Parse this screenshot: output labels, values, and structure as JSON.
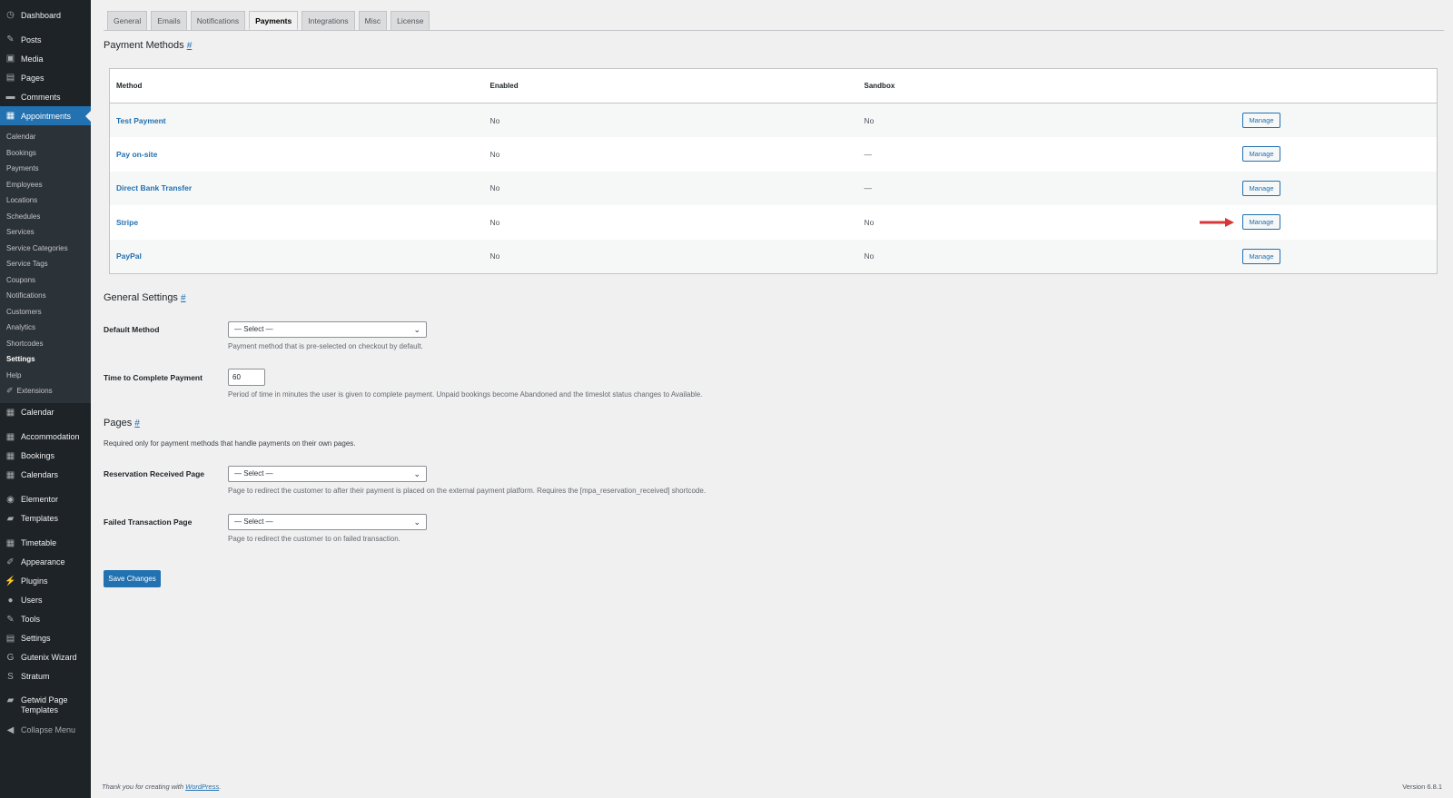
{
  "sidebar": {
    "top": [
      {
        "label": "Dashboard",
        "icon": "dashboard-icon",
        "glyph": "◷"
      },
      {
        "label": "Posts",
        "icon": "pin-icon",
        "glyph": "✎"
      },
      {
        "label": "Media",
        "icon": "media-icon",
        "glyph": "▣"
      },
      {
        "label": "Pages",
        "icon": "pages-icon",
        "glyph": "▤"
      },
      {
        "label": "Comments",
        "icon": "comments-icon",
        "glyph": "▬"
      },
      {
        "label": "Appointments",
        "icon": "calendar-icon",
        "glyph": "▦"
      }
    ],
    "appointments_sub": [
      "Calendar",
      "Bookings",
      "Payments",
      "Employees",
      "Locations",
      "Schedules",
      "Services",
      "Service Categories",
      "Service Tags",
      "Coupons",
      "Notifications",
      "Customers",
      "Analytics",
      "Shortcodes",
      "Settings",
      "Help",
      "Extensions"
    ],
    "rest": [
      {
        "label": "Calendar",
        "icon": "calendar-icon",
        "glyph": "▦"
      },
      {
        "label": "Accommodation",
        "icon": "calendar-icon",
        "glyph": "▦"
      },
      {
        "label": "Bookings",
        "icon": "calendar-icon",
        "glyph": "▦"
      },
      {
        "label": "Calendars",
        "icon": "calendar-icon",
        "glyph": "▦"
      },
      {
        "label": "Elementor",
        "icon": "elementor-icon",
        "glyph": "◉"
      },
      {
        "label": "Templates",
        "icon": "folder-icon",
        "glyph": "▰"
      },
      {
        "label": "Timetable",
        "icon": "calendar-icon",
        "glyph": "▦"
      },
      {
        "label": "Appearance",
        "icon": "brush-icon",
        "glyph": "✐"
      },
      {
        "label": "Plugins",
        "icon": "plugin-icon",
        "glyph": "⚡"
      },
      {
        "label": "Users",
        "icon": "user-icon",
        "glyph": "●"
      },
      {
        "label": "Tools",
        "icon": "wrench-icon",
        "glyph": "✎"
      },
      {
        "label": "Settings",
        "icon": "settings-icon",
        "glyph": "▤"
      },
      {
        "label": "Gutenix Wizard",
        "icon": "gutenix-icon",
        "glyph": "G"
      },
      {
        "label": "Stratum",
        "icon": "stratum-icon",
        "glyph": "S"
      }
    ],
    "getwid_line1": "Getwid Page",
    "getwid_line2": "Templates",
    "collapse": "Collapse Menu"
  },
  "tabs": [
    "General",
    "Emails",
    "Notifications",
    "Payments",
    "Integrations",
    "Misc",
    "License"
  ],
  "active_tab": "Payments",
  "payment_methods": {
    "title": "Payment Methods",
    "anchor": "#",
    "headers": [
      "Method",
      "Enabled",
      "Sandbox"
    ],
    "rows": [
      {
        "method": "Test Payment",
        "enabled": "No",
        "sandbox": "No",
        "action": "Manage"
      },
      {
        "method": "Pay on-site",
        "enabled": "No",
        "sandbox": "—",
        "action": "Manage"
      },
      {
        "method": "Direct Bank Transfer",
        "enabled": "No",
        "sandbox": "—",
        "action": "Manage"
      },
      {
        "method": "Stripe",
        "enabled": "No",
        "sandbox": "No",
        "action": "Manage"
      },
      {
        "method": "PayPal",
        "enabled": "No",
        "sandbox": "No",
        "action": "Manage"
      }
    ]
  },
  "general_settings": {
    "title": "General Settings",
    "anchor": "#",
    "default_method_label": "Default Method",
    "default_method_value": "— Select —",
    "default_method_desc": "Payment method that is pre-selected on checkout by default.",
    "time_label": "Time to Complete Payment",
    "time_value": "60",
    "time_desc": "Period of time in minutes the user is given to complete payment. Unpaid bookings become Abandoned and the timeslot status changes to Available."
  },
  "pages": {
    "title": "Pages",
    "anchor": "#",
    "intro": "Required only for payment methods that handle payments on their own pages.",
    "reservation_label": "Reservation Received Page",
    "reservation_value": "— Select —",
    "reservation_desc": "Page to redirect the customer to after their payment is placed on the external payment platform. Requires the [mpa_reservation_received] shortcode.",
    "failed_label": "Failed Transaction Page",
    "failed_value": "— Select —",
    "failed_desc": "Page to redirect the customer to on failed transaction."
  },
  "save_label": "Save Changes",
  "footer": {
    "thanks_prefix": "Thank you for creating with ",
    "thanks_link": "WordPress",
    "thanks_suffix": ".",
    "version": "Version 6.8.1"
  },
  "colors": {
    "accent": "#2271b1",
    "sidebar": "#1d2327",
    "arrow": "#d63638"
  }
}
